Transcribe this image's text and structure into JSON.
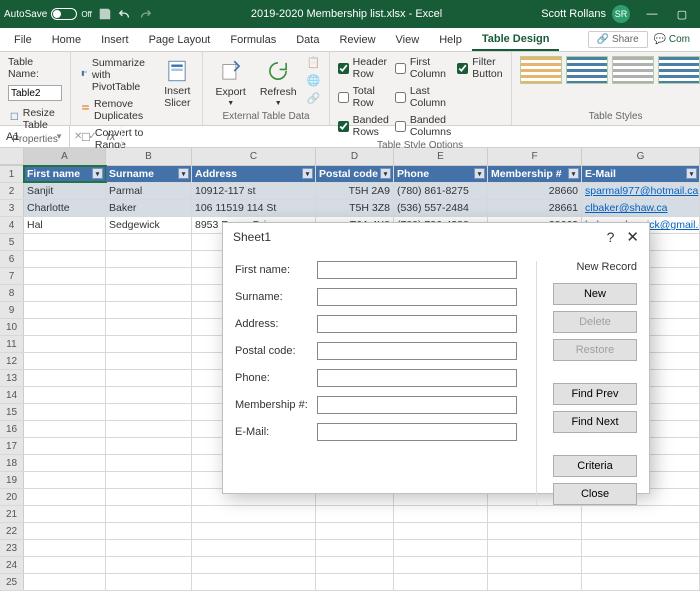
{
  "titlebar": {
    "autosave_label": "AutoSave",
    "autosave_state": "Off",
    "doc_title": "2019-2020 Membership list.xlsx - Excel",
    "user_name": "Scott Rollans",
    "user_initials": "SR"
  },
  "menu": {
    "tabs": [
      "File",
      "Home",
      "Insert",
      "Page Layout",
      "Formulas",
      "Data",
      "Review",
      "View",
      "Help",
      "Table Design"
    ],
    "active": "Table Design",
    "share": "Share",
    "comments": "Com"
  },
  "ribbon": {
    "properties": {
      "label": "Properties",
      "tablename_label": "Table Name:",
      "tablename_value": "Table2",
      "resize": "Resize Table"
    },
    "tools": {
      "label": "Tools",
      "pivot": "Summarize with PivotTable",
      "dup": "Remove Duplicates",
      "range": "Convert to Range",
      "slicer": "Insert\nSlicer"
    },
    "ext": {
      "label": "External Table Data",
      "export": "Export",
      "refresh": "Refresh"
    },
    "styleopts": {
      "label": "Table Style Options",
      "header_row": "Header Row",
      "total_row": "Total Row",
      "banded_rows": "Banded Rows",
      "first_col": "First Column",
      "last_col": "Last Column",
      "banded_cols": "Banded Columns",
      "filter_btn": "Filter Button"
    },
    "styles": {
      "label": "Table Styles"
    }
  },
  "cellref": "A1",
  "table": {
    "headers": [
      "First name",
      "Surname",
      "Address",
      "Postal code",
      "Phone",
      "Membership #",
      "E-Mail"
    ],
    "rows": [
      {
        "first": "Sanjit",
        "surname": "Parmal",
        "address": "10912-117 st",
        "postal": "T5H 2A9",
        "phone": "(780) 861-8275",
        "member": "28660",
        "email": "sparmal977@hotmail.ca"
      },
      {
        "first": "Charlotte",
        "surname": "Baker",
        "address": "106 11519 114 St",
        "postal": "T5H 3Z8",
        "phone": "(536) 557-2484",
        "member": "28661",
        "email": "clbaker@shaw.ca"
      },
      {
        "first": "Hal",
        "surname": "Sedgewick",
        "address": "8953 Roper Drive",
        "postal": "T6A 4X8",
        "phone": "(780) 786-4388",
        "member": "28662",
        "email": "hal.e.sedgewick@gmail.com"
      }
    ]
  },
  "columns": [
    "A",
    "B",
    "C",
    "D",
    "E",
    "F",
    "G"
  ],
  "dialog": {
    "title": "Sheet1",
    "status": "New Record",
    "labels": {
      "first": "First name:",
      "surname": "Surname:",
      "address": "Address:",
      "postal": "Postal code:",
      "phone": "Phone:",
      "member": "Membership #:",
      "email": "E-Mail:"
    },
    "buttons": {
      "new": "New",
      "delete": "Delete",
      "restore": "Restore",
      "findprev": "Find Prev",
      "findnext": "Find Next",
      "criteria": "Criteria",
      "close": "Close"
    }
  }
}
